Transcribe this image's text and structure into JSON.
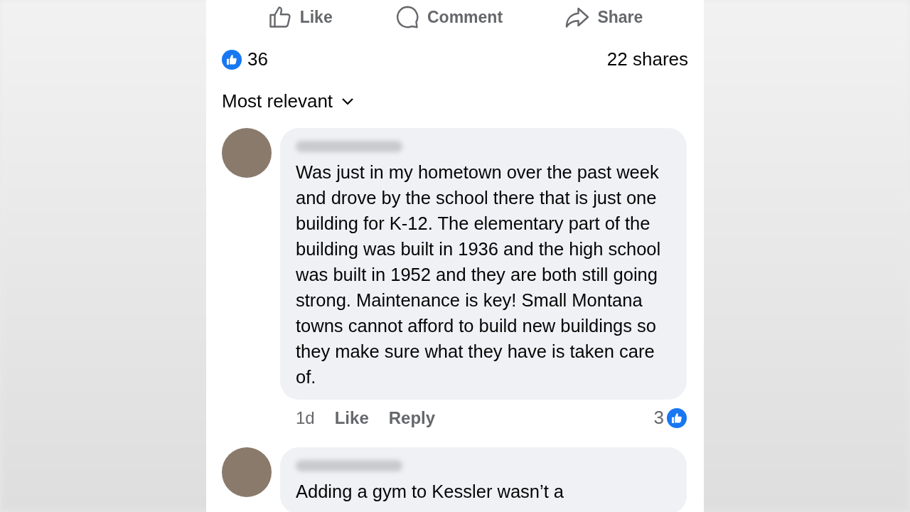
{
  "actions": [
    {
      "kind": "like",
      "label": "Like"
    },
    {
      "kind": "comment",
      "label": "Comment"
    },
    {
      "kind": "share",
      "label": "Share"
    }
  ],
  "reactions": {
    "count": "36",
    "shares": "22 shares"
  },
  "sort": {
    "label": "Most relevant"
  },
  "comments": [
    {
      "text": "Was just in my hometown over the past week and drove by the school there that is just one building for K-12. The elementary part of the building was built in 1936 and the high school was built in 1952 and they are both still going strong. Maintenance is key! Small Montana towns cannot afford to build new buildings so they make sure what they have is taken care of.",
      "time": "1d",
      "like_label": "Like",
      "reply_label": "Reply",
      "reaction_count": "3"
    },
    {
      "text": "Adding a gym to Kessler wasn’t a"
    }
  ]
}
